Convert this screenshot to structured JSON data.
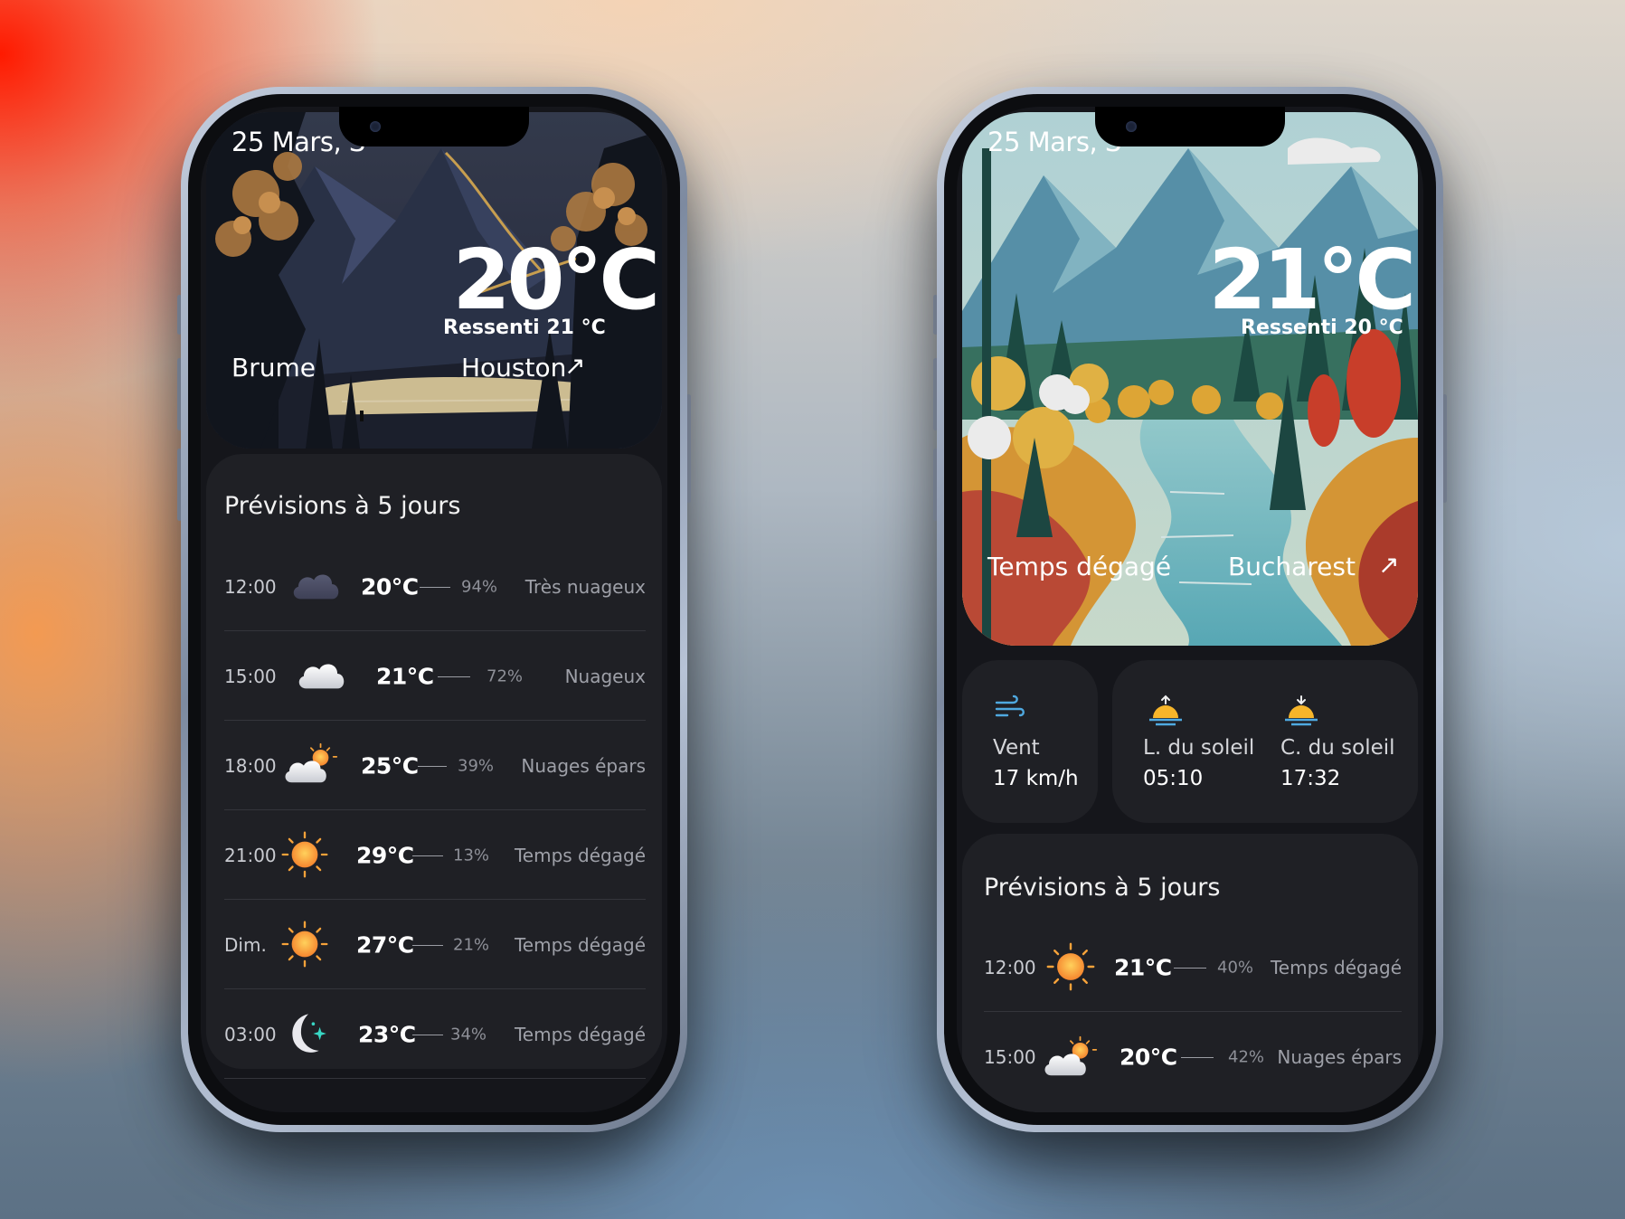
{
  "phones": [
    {
      "date": "25 Mars, S",
      "temperature": "20°C",
      "feels_like": "Ressenti 21 °C",
      "condition": "Brume",
      "city": "Houston",
      "forecast_title": "Prévisions à 5 jours",
      "forecast": [
        {
          "time": "12:00",
          "icon": "dark-cloud-icon",
          "temp": "20°C",
          "pct": "94%",
          "desc": "Très nuageux"
        },
        {
          "time": "15:00",
          "icon": "cloud-icon",
          "temp": "21°C",
          "pct": "72%",
          "desc": "Nuageux"
        },
        {
          "time": "18:00",
          "icon": "partly-cloudy-icon",
          "temp": "25°C",
          "pct": "39%",
          "desc": "Nuages épars"
        },
        {
          "time": "21:00",
          "icon": "sun-icon",
          "temp": "29°C",
          "pct": "13%",
          "desc": "Temps dégagé"
        },
        {
          "time": "Dim.",
          "icon": "sun-icon",
          "temp": "27°C",
          "pct": "21%",
          "desc": "Temps dégagé"
        },
        {
          "time": "03:00",
          "icon": "moon-icon",
          "temp": "23°C",
          "pct": "34%",
          "desc": "Temps dégagé"
        }
      ]
    },
    {
      "date": "25 Mars, S",
      "temperature": "21°C",
      "feels_like": "Ressenti 20 °C",
      "condition": "Temps dégagé",
      "city": "Bucharest",
      "stats": {
        "wind_label": "Vent",
        "wind_value": "17 km/h",
        "sunrise_label": "L. du soleil",
        "sunrise_value": "05:10",
        "sunset_label": "C. du soleil",
        "sunset_value": "17:32"
      },
      "forecast_title": "Prévisions à 5 jours",
      "forecast": [
        {
          "time": "12:00",
          "icon": "sun-icon",
          "temp": "21°C",
          "pct": "40%",
          "desc": "Temps dégagé"
        },
        {
          "time": "15:00",
          "icon": "partly-cloudy-icon",
          "temp": "20°C",
          "pct": "42%",
          "desc": "Nuages épars"
        }
      ]
    }
  ],
  "colors": {
    "card": "#1f2025",
    "screen": "#15161b",
    "sun": "#f6a23a",
    "wind": "#4fa9e0"
  }
}
